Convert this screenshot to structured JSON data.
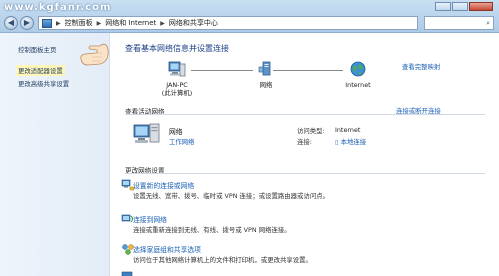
{
  "watermark": "www.kgfanr.com",
  "address_bar": {
    "crumbs": [
      "控制面板",
      "网络和 Internet",
      "网络和共享中心"
    ]
  },
  "search": {
    "placeholder": ""
  },
  "left_pane": {
    "home": "控制面板主页",
    "adapter_settings": "更改适配器设置",
    "advanced_sharing": "更改高级共享设置"
  },
  "main": {
    "title": "查看基本网络信息并设置连接",
    "full_map": "查看完整映射",
    "map": {
      "computer": "JAN-PC",
      "computer_sub": "(此计算机)",
      "network": "网络",
      "internet": "Internet"
    },
    "active_networks_head": "查看活动网络",
    "connect_disconnect": "连接或断开连接",
    "network_name": "网络",
    "network_kind": "工作网络",
    "access_type_label": "访问类型:",
    "access_type_value": "Internet",
    "connections_label": "连接:",
    "connections_value": "本地连接",
    "change_settings_head": "更改网络设置",
    "tasks": [
      {
        "title": "设置新的连接或网络",
        "desc": "设置无线、宽带、拨号、临时或 VPN 连接；或设置路由器或访问点。"
      },
      {
        "title": "连接到网络",
        "desc": "连接或重新连接到无线、有线、拨号或 VPN 网络连接。"
      },
      {
        "title": "选择家庭组和共享选项",
        "desc": "访问位于其他网络计算机上的文件和打印机，或更改共享设置。"
      }
    ]
  },
  "colors": {
    "link": "#1a5fb4",
    "title": "#1b3f8a",
    "highlight": "#fff7b8"
  }
}
